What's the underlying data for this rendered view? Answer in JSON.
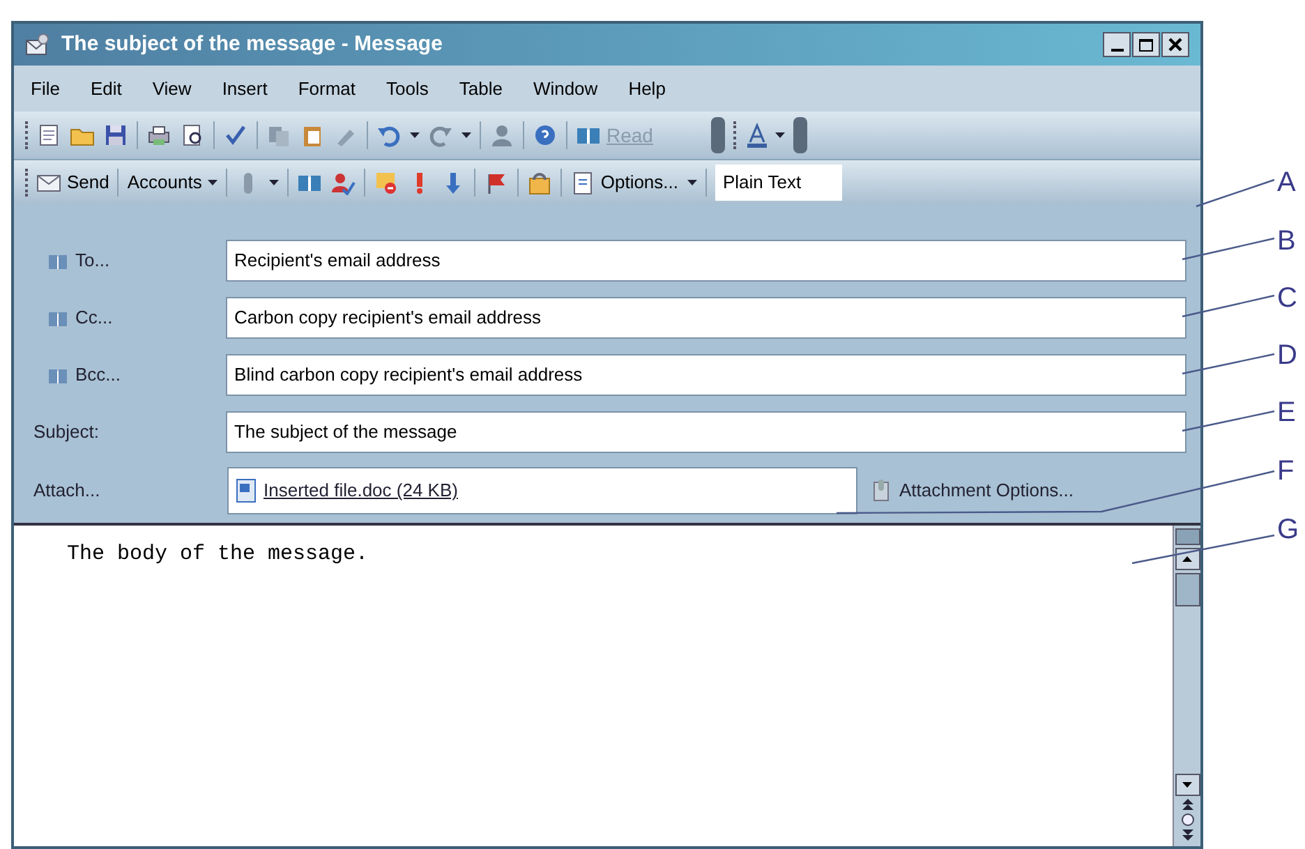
{
  "window": {
    "title": "The subject of the message - Message"
  },
  "menu": [
    "File",
    "Edit",
    "View",
    "Insert",
    "Format",
    "Tools",
    "Table",
    "Window",
    "Help"
  ],
  "standard_toolbar": {
    "read_button": {
      "label": "Read",
      "disabled": true
    }
  },
  "message_toolbar": {
    "send": "Send",
    "accounts": "Accounts",
    "options": "Options...",
    "format": "Plain Text"
  },
  "headers": [
    {
      "kind": "address",
      "label": "To...",
      "value": "Recipient's email address"
    },
    {
      "kind": "address",
      "label": "Cc...",
      "value": "Carbon copy recipient's email address"
    },
    {
      "kind": "address",
      "label": "Bcc...",
      "value": "Blind carbon copy recipient's email address"
    },
    {
      "kind": "text",
      "label": "Subject:",
      "value": "The subject of the message"
    }
  ],
  "attach": {
    "label": "Attach...",
    "file": "Inserted file.doc (24 KB)",
    "options_button": "Attachment Options..."
  },
  "body": {
    "text": "The body of the message."
  },
  "callouts": [
    "A",
    "B",
    "C",
    "D",
    "E",
    "F",
    "G"
  ]
}
